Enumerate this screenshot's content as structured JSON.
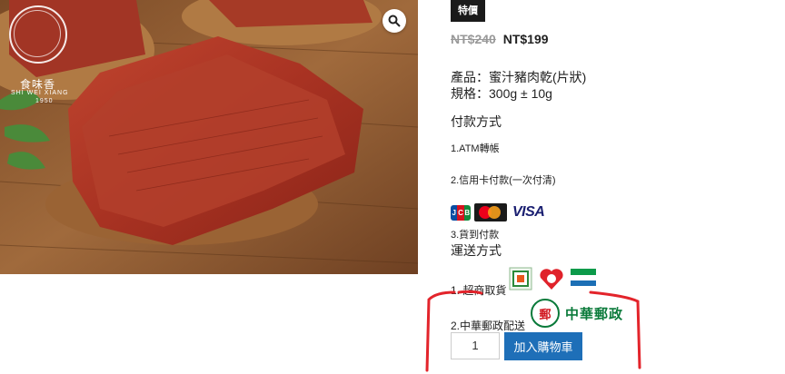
{
  "gallery": {
    "zoom_icon": "magnifier-icon",
    "logo": {
      "cn": "食味香",
      "en": "SHI WEI XIANG",
      "year": "1950"
    }
  },
  "badge": "特價",
  "price": {
    "old": "NT$240",
    "new": "NT$199"
  },
  "product": {
    "name": "產品：蜜汁豬肉乾(片狀)",
    "spec": "規格：300g ± 10g"
  },
  "payment": {
    "heading": "付款方式",
    "option1": "1.ATM轉帳",
    "option2": "2.信用卡付款(一次付清)",
    "cards": [
      "JCB",
      "MasterCard",
      "VISA"
    ],
    "option3": "3.貨到付款"
  },
  "shipping": {
    "heading": "運送方式",
    "option1": "1. 超商取貨",
    "stores": [
      "7-ELEVEN",
      "Hi-Life",
      "FamilyMart"
    ],
    "option2": "2.中華郵政配送",
    "post_logo": "中華郵政"
  },
  "cart": {
    "qty": "1",
    "button": "加入購物車"
  },
  "colors": {
    "button": "#1e6fb8",
    "badge": "#1a1a1a",
    "annotation": "#e3242b",
    "post_green": "#0a7a3a"
  }
}
